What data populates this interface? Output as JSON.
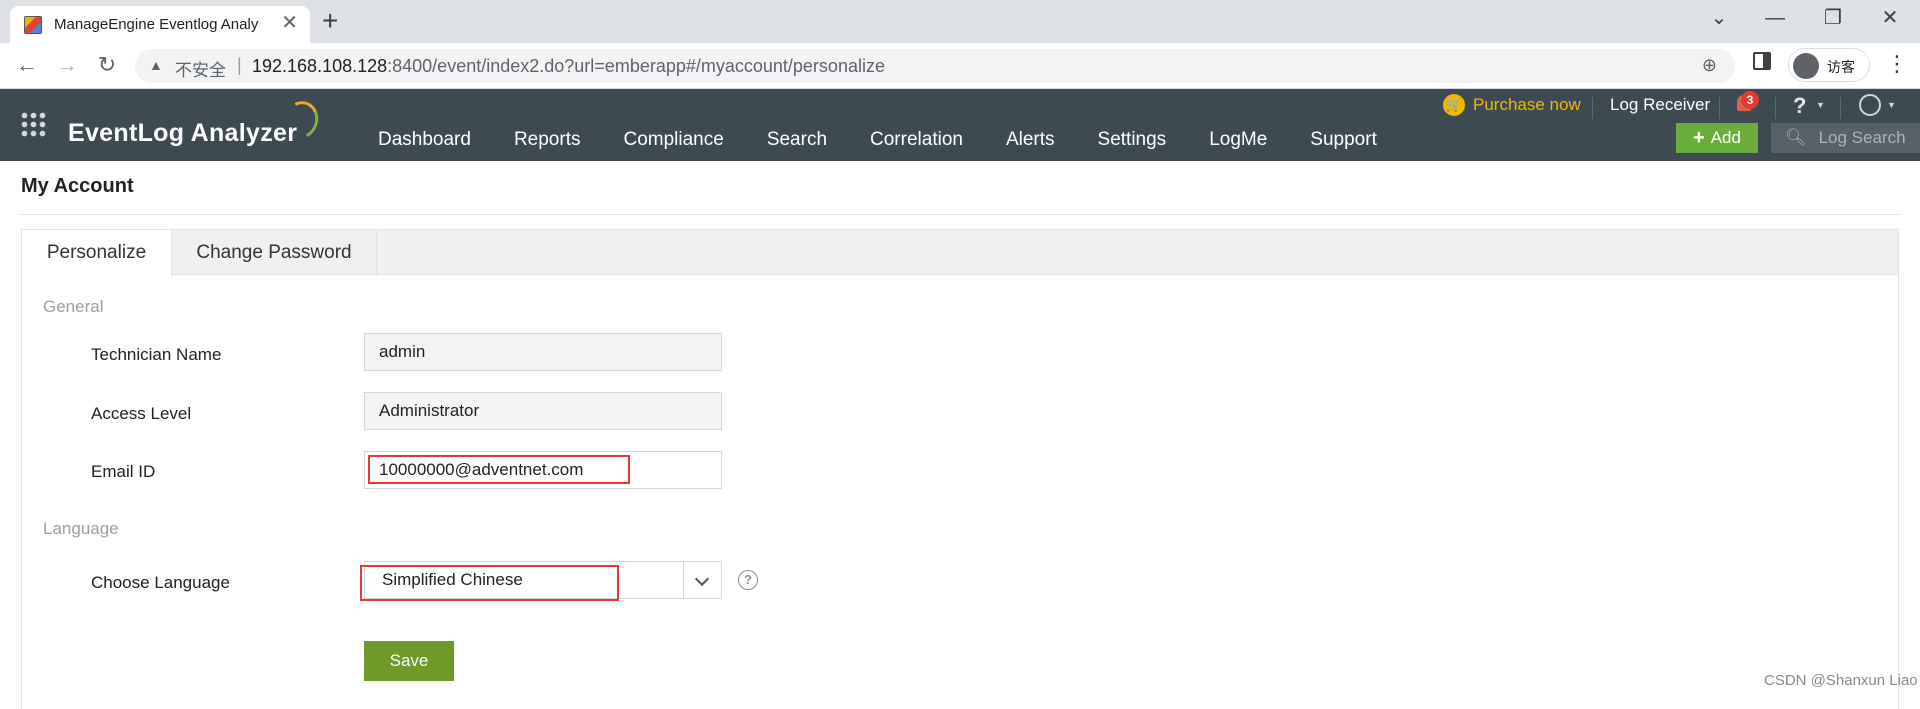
{
  "browser": {
    "tab_title": "ManageEngine Eventlog Analy",
    "tab_close": "✕",
    "new_tab": "+",
    "security_label": "不安全",
    "url_host": "192.168.108.128",
    "url_rest": ":8400/event/index2.do?url=emberapp#/myaccount/personalize",
    "profile_label": "访客"
  },
  "header": {
    "logo": "EventLog Analyzer",
    "nav": [
      "Dashboard",
      "Reports",
      "Compliance",
      "Search",
      "Correlation",
      "Alerts",
      "Settings",
      "LogMe",
      "Support"
    ],
    "purchase_label": "Purchase now",
    "log_receiver": "Log Receiver",
    "notification_count": "3",
    "help": "?",
    "add_label": "Add",
    "log_search_placeholder": "Log Search",
    "accent_color": "#6aad3d",
    "purchase_color": "#f5b800"
  },
  "page": {
    "title": "My Account",
    "tabs": [
      {
        "label": "Personalize",
        "active": true
      },
      {
        "label": "Change Password",
        "active": false
      }
    ],
    "general_section": "General",
    "fields": {
      "technician_name": {
        "label": "Technician Name",
        "value": "admin"
      },
      "access_level": {
        "label": "Access Level",
        "value": "Administrator"
      },
      "email": {
        "label": "Email ID",
        "value": "10000000@adventnet.com"
      }
    },
    "language_section": "Language",
    "language": {
      "label": "Choose Language",
      "value": "Simplified Chinese"
    },
    "save_label": "Save",
    "highlight_color": "#e53935"
  },
  "watermark": "CSDN @Shanxun Liao"
}
